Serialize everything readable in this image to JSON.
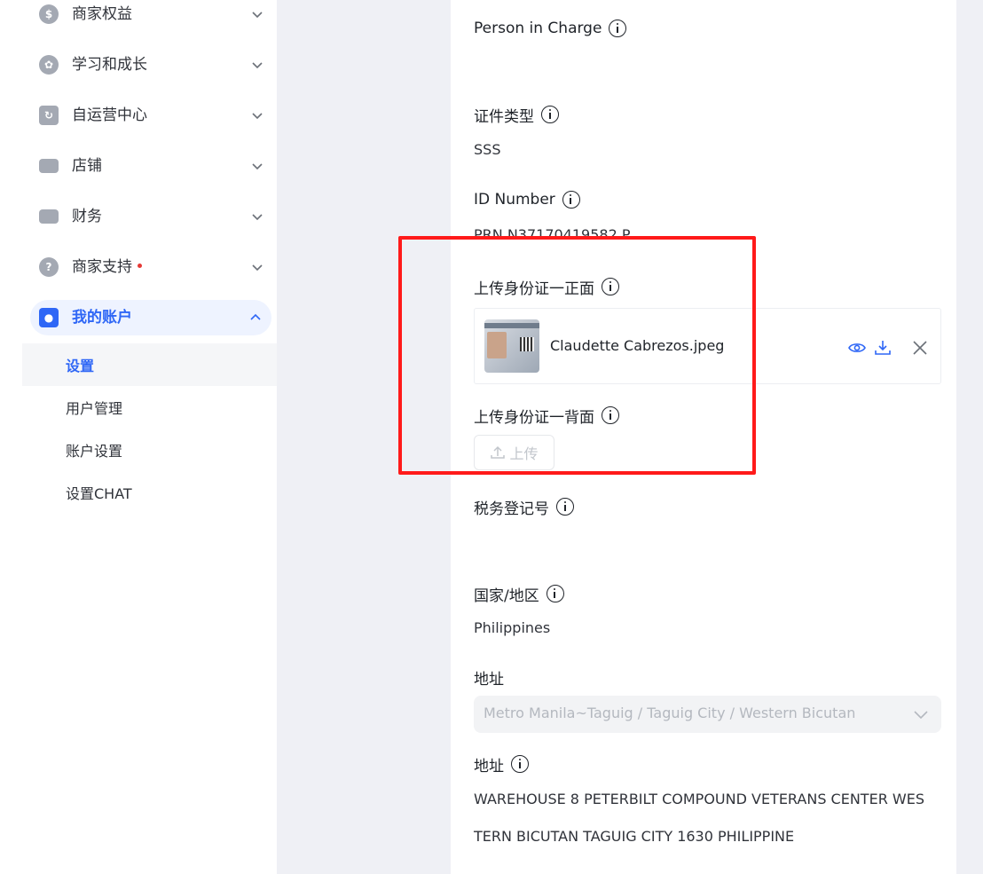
{
  "sidebar": {
    "items": [
      {
        "label": "商家权益",
        "icon": "dollar-icon"
      },
      {
        "label": "学习和成长",
        "icon": "sprout-icon"
      },
      {
        "label": "自运营中心",
        "icon": "refresh-icon"
      },
      {
        "label": "店铺",
        "icon": "store-icon"
      },
      {
        "label": "财务",
        "icon": "wallet-icon"
      },
      {
        "label": "商家支持",
        "icon": "question-icon"
      },
      {
        "label": "我的账户",
        "icon": "user-icon"
      }
    ],
    "sub_items": [
      {
        "label": "设置"
      },
      {
        "label": "用户管理"
      },
      {
        "label": "账户设置"
      },
      {
        "label": "设置CHAT"
      }
    ]
  },
  "form": {
    "person_in_charge_label": "Person in Charge",
    "id_type_label": "证件类型",
    "id_type_value": "SSS",
    "id_number_label": "ID Number",
    "id_number_value": "PRN N37170419582 P",
    "id_front_label": "上传身份证一正面",
    "id_front_file": "Claudette Cabrezos.jpeg",
    "id_back_label": "上传身份证一背面",
    "upload_label": "上传",
    "tax_label": "税务登记号",
    "country_label": "国家/地区",
    "country_value": "Philippines",
    "address_select_label": "地址",
    "address_select_value": "Metro Manila~Taguig / Taguig City / Western Bicutan",
    "address_label": "地址",
    "address_line1": "WAREHOUSE 8 PETERBILT COMPOUND VETERANS CENTER WES",
    "address_line2": "TERN BICUTAN TAGUIG CITY 1630 PHILIPPINE"
  },
  "colors": {
    "accent": "#2f67f6",
    "highlight": "#ff1a1a",
    "background": "#eff0f5"
  }
}
